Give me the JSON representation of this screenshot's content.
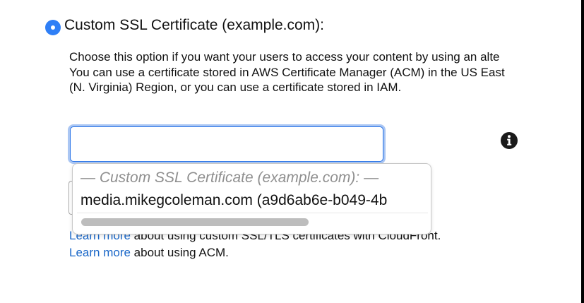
{
  "ssl_option": {
    "label": "Custom SSL Certificate (example.com):",
    "selected": true
  },
  "description": {
    "line1": "Choose this option if you want your users to access your content by using an alte",
    "line2": "You can use a certificate stored in AWS Certificate Manager (ACM) in the US East",
    "line3": "(N. Virginia) Region, or you can use a certificate stored in IAM."
  },
  "certificate_input": {
    "value": "",
    "placeholder": ""
  },
  "dropdown": {
    "group_label": "— Custom SSL Certificate (example.com): —",
    "options": [
      "media.mikegcoleman.com (a9d6ab6e-b049-4b"
    ]
  },
  "help": {
    "ssl_tls_link": "Learn more",
    "ssl_tls_text": " about using custom SSL/TLS certificates with CloudFront.",
    "acm_link": "Learn more",
    "acm_text": " about using ACM."
  },
  "icons": {
    "info": "info-circle-icon"
  },
  "colors": {
    "radio": "#2f7ff6",
    "focus_border": "#2873e8",
    "link": "#1a67c8"
  }
}
